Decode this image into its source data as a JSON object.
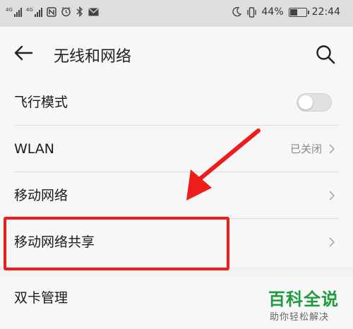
{
  "status_bar": {
    "signal1_label": "4G",
    "signal2_label": "4G",
    "battery_percent": "44%",
    "time": "22:44"
  },
  "app_bar": {
    "title": "无线和网络"
  },
  "settings": {
    "items": [
      {
        "label": "飞行模式",
        "toggle_on": false
      },
      {
        "label": "WLAN",
        "value": "已关闭"
      },
      {
        "label": "移动网络"
      },
      {
        "label": "移动网络共享"
      }
    ],
    "section2_item": {
      "label": "双卡管理"
    }
  },
  "watermark": {
    "title": "百科全说",
    "subtitle": "助你轻松解决"
  },
  "colors": {
    "highlight": "#ef1c1c",
    "watermark_green": "#1e9b3c"
  }
}
